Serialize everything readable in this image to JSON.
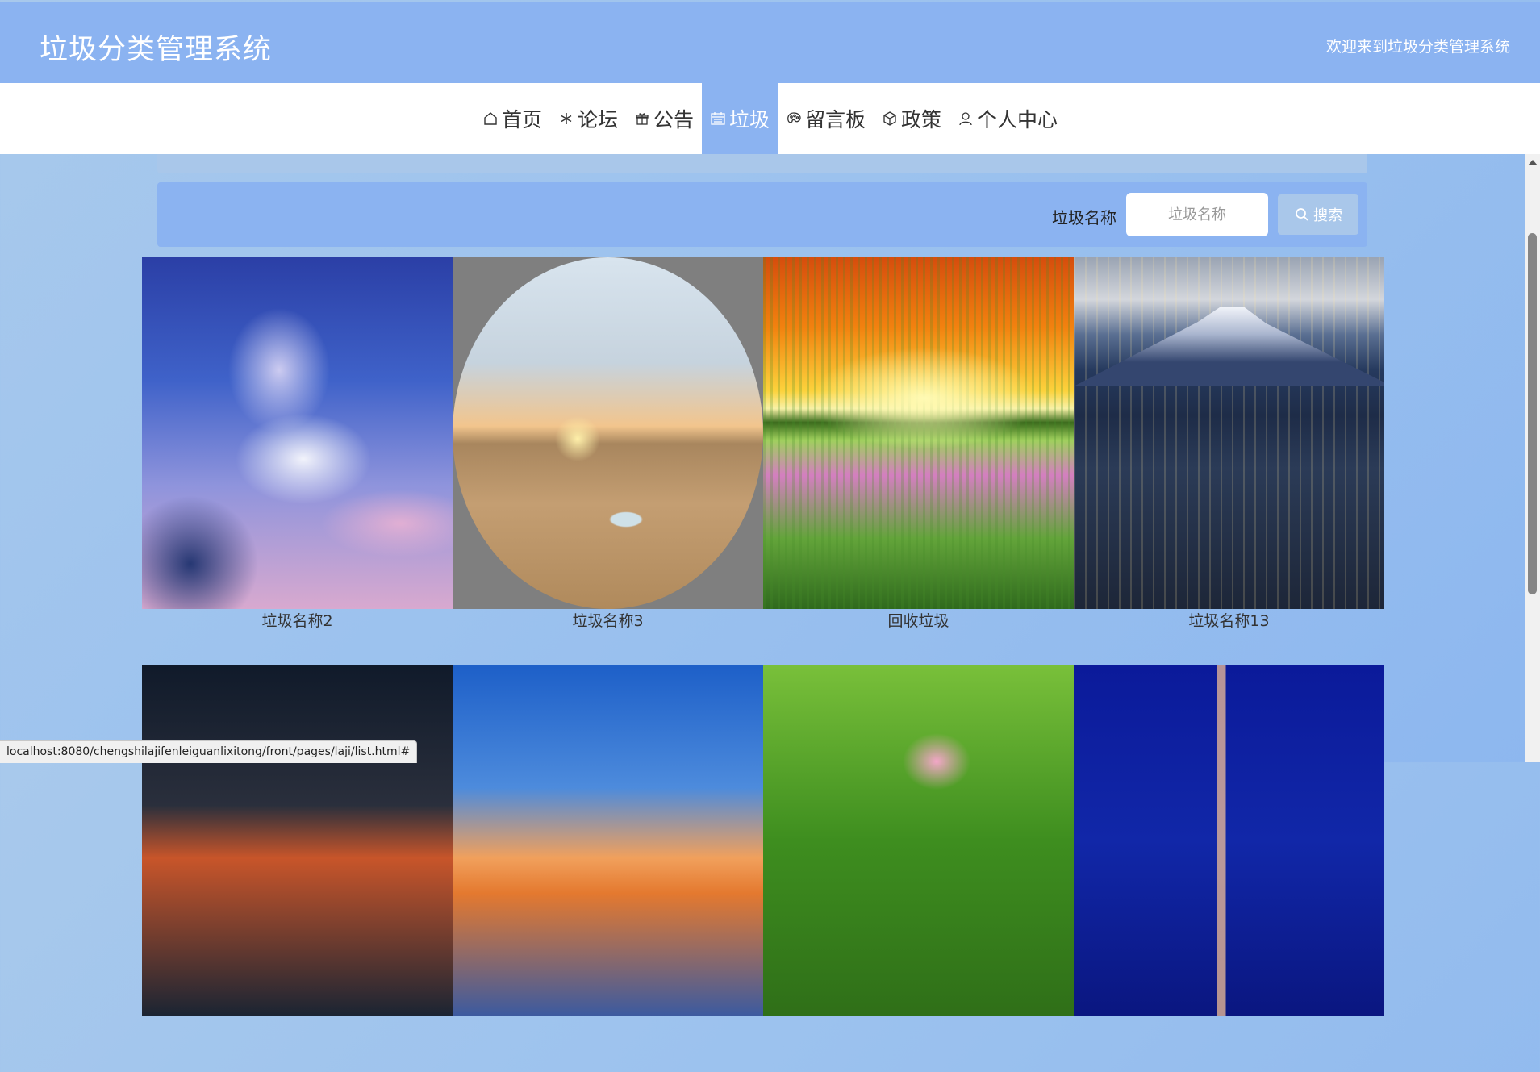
{
  "header": {
    "title": "垃圾分类管理系统",
    "welcome": "欢迎来到垃圾分类管理系统"
  },
  "nav": {
    "items": [
      {
        "label": "首页",
        "icon": "home-icon"
      },
      {
        "label": "论坛",
        "icon": "snowflake-icon"
      },
      {
        "label": "公告",
        "icon": "gift-icon"
      },
      {
        "label": "垃圾",
        "icon": "calendar-icon",
        "active": true
      },
      {
        "label": "留言板",
        "icon": "palette-icon"
      },
      {
        "label": "政策",
        "icon": "box-icon"
      },
      {
        "label": "个人中心",
        "icon": "user-icon"
      }
    ]
  },
  "search": {
    "label": "垃圾名称",
    "placeholder": "垃圾名称",
    "value": "",
    "button_label": "搜索",
    "button_icon": "search-icon"
  },
  "items": [
    {
      "name": "垃圾名称2"
    },
    {
      "name": "垃圾名称3"
    },
    {
      "name": "回收垃圾"
    },
    {
      "name": "垃圾名称13"
    },
    {
      "name": ""
    },
    {
      "name": ""
    },
    {
      "name": ""
    },
    {
      "name": ""
    }
  ],
  "status_url": "localhost:8080/chengshilajifenleiguanlixitong/front/pages/laji/list.html#",
  "colors": {
    "primary": "#8bb3f1",
    "secondary": "#a9c7ea",
    "nav_background": "#ffffff"
  }
}
